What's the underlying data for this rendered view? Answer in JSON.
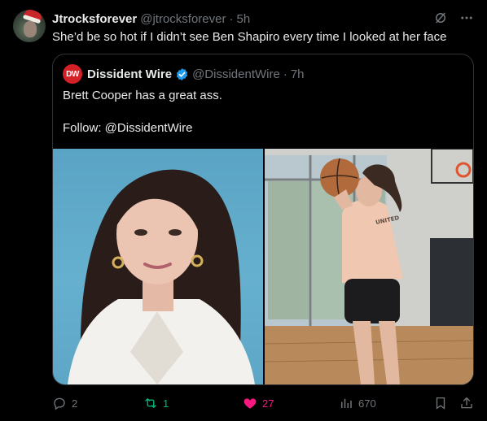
{
  "tweet": {
    "author_name": "Jtrocksforever",
    "author_handle": "@jtrocksforever",
    "separator": "·",
    "time": "5h",
    "text": "She’d be so hot if I didn’t see Ben Shapiro every time I looked at her face"
  },
  "quoted": {
    "logo_text": "DW",
    "author_name": "Dissident Wire",
    "author_handle": "@DissidentWire",
    "separator": "·",
    "time": "7h",
    "text": "Brett Cooper has a great ass.\n\nFollow: @DissidentWire",
    "media": [
      {
        "icon": "portrait-photo"
      },
      {
        "icon": "basketball-photo",
        "shirt_text": "UNITED"
      }
    ]
  },
  "actions": {
    "reply_count": "2",
    "repost_count": "1",
    "like_count": "27",
    "views_count": "670"
  },
  "colors": {
    "background": "#000000",
    "text": "#e7e9ea",
    "muted": "#71767b",
    "repost_green": "#00ba7c",
    "like_pink": "#f91880",
    "verified_blue": "#1d9bf0",
    "dw_red": "#d42027"
  }
}
